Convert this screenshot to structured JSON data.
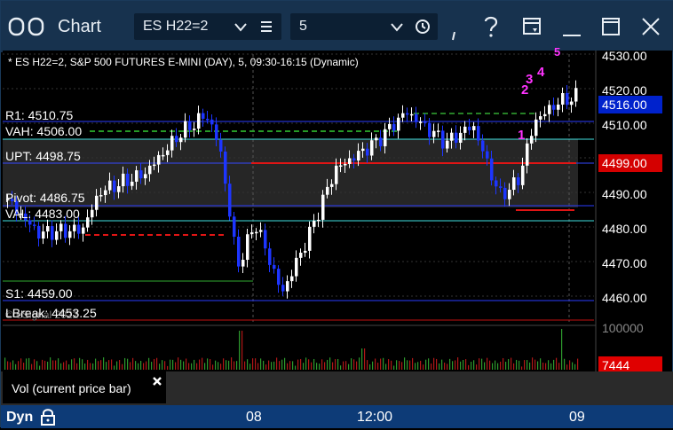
{
  "window": {
    "title": "Chart",
    "symbol": "ES H22=2",
    "interval": "5"
  },
  "chart": {
    "description": "* ES H22=2, S&P 500 FUTURES E-MINI (DAY), 5, 09:30-16:15 (Dynamic)",
    "levels": {
      "r1": "R1: 4510.75",
      "vah": "VAH: 4506.00",
      "upt": "UPT: 4498.75",
      "pivot": "Pivot: 4486.75",
      "val": "VAL: 4483.00",
      "s1": "S1: 4459.00",
      "lbreak": "LBreak: 4453.25"
    },
    "watermark": "© eSignal 2022",
    "last_price": "4516.00",
    "marker_price": "4499.00",
    "price_axis": [
      "4530.00",
      "4520.00",
      "4510.00",
      "4500.00",
      "4490.00",
      "4480.00",
      "4470.00",
      "4460.00"
    ],
    "volume_axis": "100000",
    "volume_value": "7444",
    "count_labels": [
      "3",
      "2",
      "4",
      "5",
      "1"
    ]
  },
  "study": {
    "label": "Vol (current price bar)"
  },
  "time_axis": {
    "mode": "Dyn",
    "labels": [
      "08",
      "12:00",
      "09"
    ]
  },
  "colors": {
    "titlebar": "#17324e",
    "up_candle": "#ffffff",
    "down_candle": "#1d35ff",
    "last_price_tag": "#0022cc",
    "marker_tag": "#d40000",
    "count_magenta": "#ff33ff",
    "time_axis_bg": "#0d3b77"
  },
  "icons": [
    "layout-icon",
    "chevron-down-icon",
    "menu-icon",
    "clock-icon",
    "help-icon",
    "template-icon",
    "minimize-icon",
    "maximize-icon",
    "close-icon",
    "lock-icon"
  ]
}
